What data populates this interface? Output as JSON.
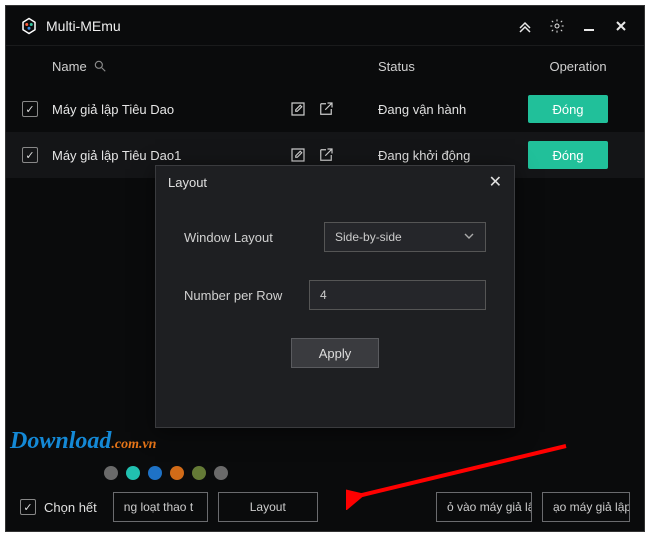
{
  "app": {
    "title": "Multi-MEmu"
  },
  "columns": {
    "name": "Name",
    "status": "Status",
    "operation": "Operation"
  },
  "rows": [
    {
      "name": "Máy giả lập Tiêu Dao",
      "status": "Đang vận hành",
      "op": "Đóng"
    },
    {
      "name": "Máy giả lập Tiêu Dao1",
      "status": "Đang khởi động",
      "op": "Đóng"
    }
  ],
  "dialog": {
    "title": "Layout",
    "window_layout_label": "Window Layout",
    "window_layout_value": "Side-by-side",
    "number_per_row_label": "Number per Row",
    "number_per_row_value": "4",
    "apply": "Apply"
  },
  "bottom": {
    "select_all": "Chọn hết",
    "batch": "ng loạt thao t",
    "layout": "Layout",
    "import": "ỏ vào máy giả lậ",
    "create": "ạo máy giả lập"
  },
  "watermark": {
    "main": "Download",
    "suffix": ".com.vn"
  },
  "dot_colors": [
    "#6a6a6a",
    "#21c0b0",
    "#1e72c6",
    "#d16b18",
    "#647a36",
    "#6a6a6a"
  ]
}
